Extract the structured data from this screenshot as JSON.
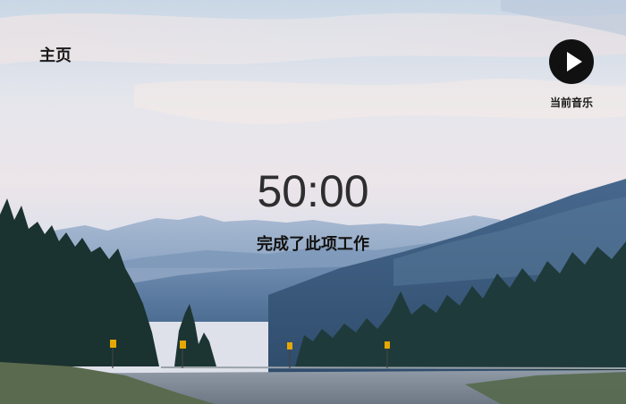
{
  "nav": {
    "home_label": "主页"
  },
  "music": {
    "label": "当前音乐",
    "icon": "play-icon"
  },
  "timer": {
    "display": "50:00"
  },
  "task": {
    "complete_label": "完成了此项工作"
  },
  "colors": {
    "text_dark": "#1a1a1a",
    "play_button_bg": "#111111",
    "timer_text": "#2e2e2e"
  }
}
